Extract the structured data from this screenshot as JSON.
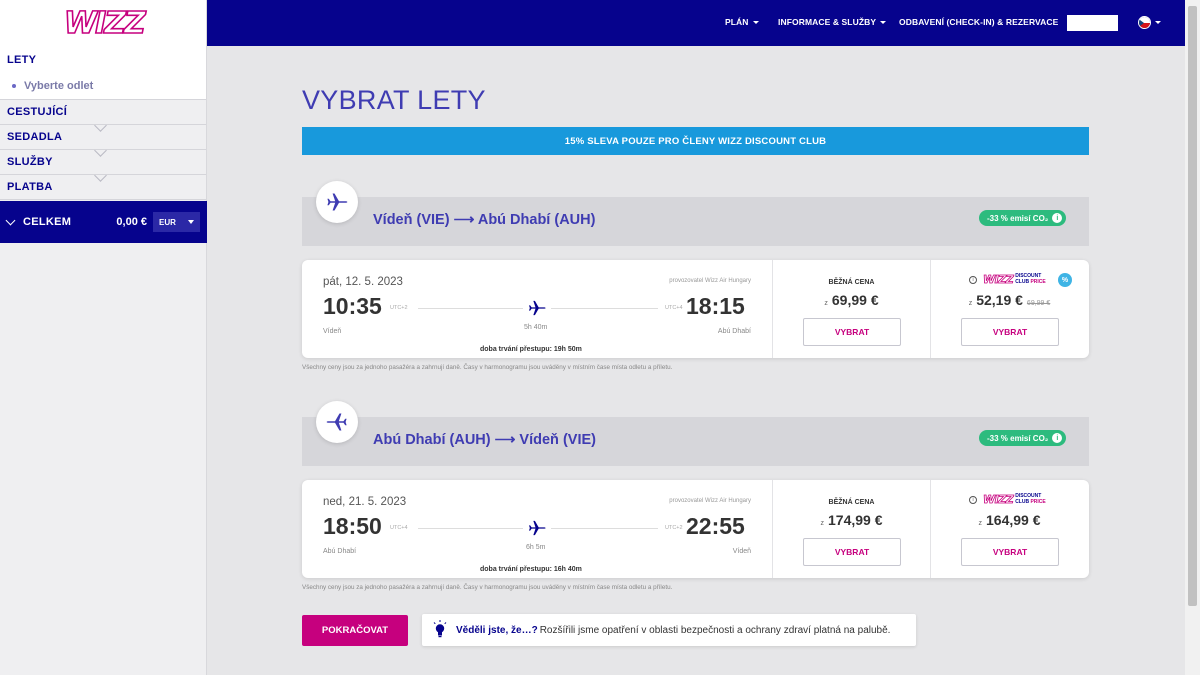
{
  "sidebar": {
    "logo": "WIZZ",
    "flights_label": "LETY",
    "flights_sub": "Vyberte odlet",
    "passengers_label": "CESTUJÍCÍ",
    "seats_label": "SEDADLA",
    "services_label": "SLUŽBY",
    "payment_label": "PLATBA",
    "total_label": "CELKEM",
    "total_amount": "0,00 €",
    "currency": "EUR"
  },
  "nav": {
    "plan": "PLÁN",
    "info": "INFORMACE & SLUŽBY",
    "checkin": "ODBAVENÍ (CHECK-IN) & REZERVACE"
  },
  "page_title": "VYBRAT LETY",
  "promo": "15% SLEVA POUZE PRO ČLENY WIZZ DISCOUNT CLUB",
  "flights": [
    {
      "route": "Vídeň (VIE) ⟶ Abú Dhabí (AUH)",
      "co2": "-33 % emisí CO₂",
      "date": "pát, 12. 5. 2023",
      "operator": "provozovatel Wizz Air Hungary",
      "dep_time": "10:35",
      "dep_utc": "UTC+2",
      "arr_time": "18:15",
      "arr_utc": "UTC+4",
      "dep_city": "Vídeň",
      "arr_city": "Abú Dhabí",
      "duration": "5h 40m",
      "transfer": "doba trvání přestupu: 19h 50m",
      "regular_label": "BĚŽNÁ CENA",
      "from": "z",
      "regular_price": "69,99 €",
      "club_price": "52,19 €",
      "club_old_price": "69,99 €",
      "club_badge": "%",
      "select": "VYBRAT"
    },
    {
      "route": "Abú Dhabí (AUH) ⟶ Vídeň (VIE)",
      "co2": "-33 % emisí CO₂",
      "date": "ned, 21. 5. 2023",
      "operator": "provozovatel Wizz Air Hungary",
      "dep_time": "18:50",
      "dep_utc": "UTC+4",
      "arr_time": "22:55",
      "arr_utc": "UTC+2",
      "dep_city": "Abú Dhabí",
      "arr_city": "Vídeň",
      "duration": "6h 5m",
      "transfer": "doba trvání přestupu: 16h 40m",
      "regular_label": "BĚŽNÁ CENA",
      "from": "z",
      "regular_price": "174,99 €",
      "club_price": "164,99 €",
      "select": "VYBRAT"
    }
  ],
  "club_logo": {
    "wizz": "WIZZ",
    "discount": "DISCOUNT",
    "club": "CLUB",
    "price": "PRICE",
    "info": "i"
  },
  "disclaimer": "Všechny ceny jsou za jednoho pasažéra a zahrnují daně. Časy v harmonogramu jsou uváděny v místním čase místa odletu a příletu.",
  "continue": "POKRAČOVAT",
  "tip": {
    "bold": "Věděli jste, že…?",
    "text": "Rozšířili jsme opatření v oblasti bezpečnosti a ochrany zdraví platná na palubě."
  },
  "colors": {
    "navy": "#06038d",
    "magenta": "#c6007e",
    "promo": "#1899dc",
    "co2": "#2dbb7e"
  }
}
